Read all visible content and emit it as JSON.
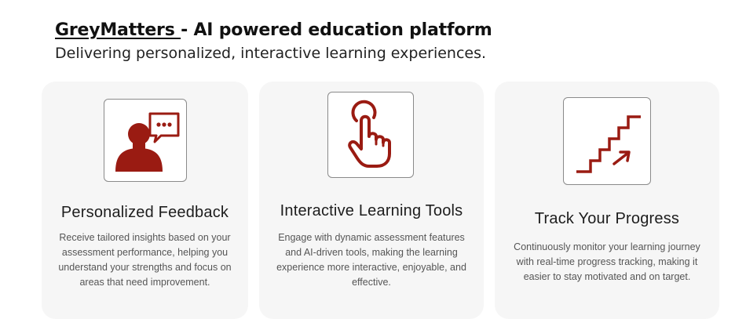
{
  "header": {
    "brand": "GreyMatters ",
    "title_rest": "- AI powered education platform",
    "subtitle": "Delivering personalized, interactive learning experiences."
  },
  "colors": {
    "accent": "#9a1b12",
    "card_bg": "#f6f6f6"
  },
  "cards": [
    {
      "icon": "speech-feedback-icon",
      "title": "Personalized Feedback",
      "lines": [
        "Receive tailored insights based on your",
        "assessment performance, helping you",
        "understand your strengths and focus on",
        "areas that need improvement."
      ]
    },
    {
      "icon": "tap-hand-icon",
      "title": "Interactive Learning Tools",
      "lines": [
        "Engage with dynamic assessment features",
        "and AI-driven tools, making the learning",
        "experience more interactive, enjoyable, and",
        "effective."
      ]
    },
    {
      "icon": "stairs-progress-icon",
      "title": "Track Your Progress",
      "lines": [
        "Continuously monitor your learning journey",
        "with real-time progress tracking, making it",
        "easier to stay motivated and on target."
      ]
    }
  ]
}
